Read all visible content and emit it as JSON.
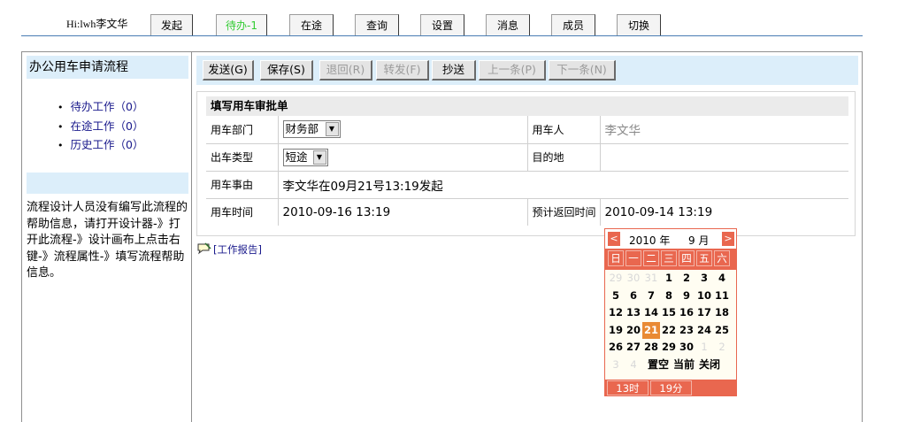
{
  "topbar": {
    "greeting": "Hi:lwh李文华",
    "tabs": [
      {
        "label": "发起"
      },
      {
        "label": "待办-1"
      },
      {
        "label": "在途"
      },
      {
        "label": "查询"
      },
      {
        "label": "设置"
      },
      {
        "label": "消息"
      },
      {
        "label": "成员"
      },
      {
        "label": "切换"
      }
    ],
    "active_tab": "待办-1",
    "accent_color": "#33cc33",
    "line_color": "#4a7db3"
  },
  "sidebar": {
    "title": "办公用车申请流程",
    "items": [
      {
        "label": "待办工作（0）"
      },
      {
        "label": "在途工作（0）"
      },
      {
        "label": "历史工作（0）"
      }
    ],
    "help_text": "流程设计人员没有编写此流程的帮助信息，请打开设计器-》打开此流程-》设计画布上点击右键-》流程属性-》填写流程帮助信息。"
  },
  "toolbar": {
    "send": "发送(G)",
    "save": "保存(S)",
    "back": "退回(R)",
    "forward": "转发(F)",
    "cc": "抄送",
    "prev": "上一条(P)",
    "next": "下一条(N)"
  },
  "form": {
    "title": "填写用车审批单",
    "dept_label": "用车部门",
    "dept_value": "财务部",
    "user_label": "用车人",
    "user_value": "李文华",
    "type_label": "出车类型",
    "type_value": "短途",
    "dest_label": "目的地",
    "dest_value": "",
    "reason_label": "用车事由",
    "reason_value": "李文华在09月21号13:19发起",
    "time_label": "用车时间",
    "time_value": "2010-09-16 13:19",
    "return_label": "预计返回时间",
    "return_value": "2010-09-14 13:19"
  },
  "report_link": "[工作报告]",
  "calendar": {
    "prev": "<",
    "next": ">",
    "year": "2010 年",
    "month": "9 月",
    "weekdays": [
      "日",
      "一",
      "二",
      "三",
      "四",
      "五",
      "六"
    ],
    "weeks": [
      [
        {
          "d": "29",
          "dim": true
        },
        {
          "d": "30",
          "dim": true
        },
        {
          "d": "31",
          "dim": true
        },
        {
          "d": "1"
        },
        {
          "d": "2"
        },
        {
          "d": "3"
        },
        {
          "d": "4"
        }
      ],
      [
        {
          "d": "5"
        },
        {
          "d": "6"
        },
        {
          "d": "7"
        },
        {
          "d": "8"
        },
        {
          "d": "9"
        },
        {
          "d": "10"
        },
        {
          "d": "11"
        }
      ],
      [
        {
          "d": "12"
        },
        {
          "d": "13"
        },
        {
          "d": "14"
        },
        {
          "d": "15"
        },
        {
          "d": "16"
        },
        {
          "d": "17"
        },
        {
          "d": "18"
        }
      ],
      [
        {
          "d": "19"
        },
        {
          "d": "20"
        },
        {
          "d": "21",
          "today": true
        },
        {
          "d": "22"
        },
        {
          "d": "23"
        },
        {
          "d": "24"
        },
        {
          "d": "25"
        }
      ],
      [
        {
          "d": "26"
        },
        {
          "d": "27"
        },
        {
          "d": "28"
        },
        {
          "d": "29"
        },
        {
          "d": "30"
        },
        {
          "d": "1",
          "dim": true
        },
        {
          "d": "2",
          "dim": true
        }
      ]
    ],
    "last_row_dim": [
      "3",
      "4"
    ],
    "actions": {
      "clear": "置空",
      "now": "当前",
      "close": "关闭"
    },
    "hour": "13时",
    "minute": "19分",
    "theme_color": "#e9674f",
    "today_color": "#e98a34"
  }
}
